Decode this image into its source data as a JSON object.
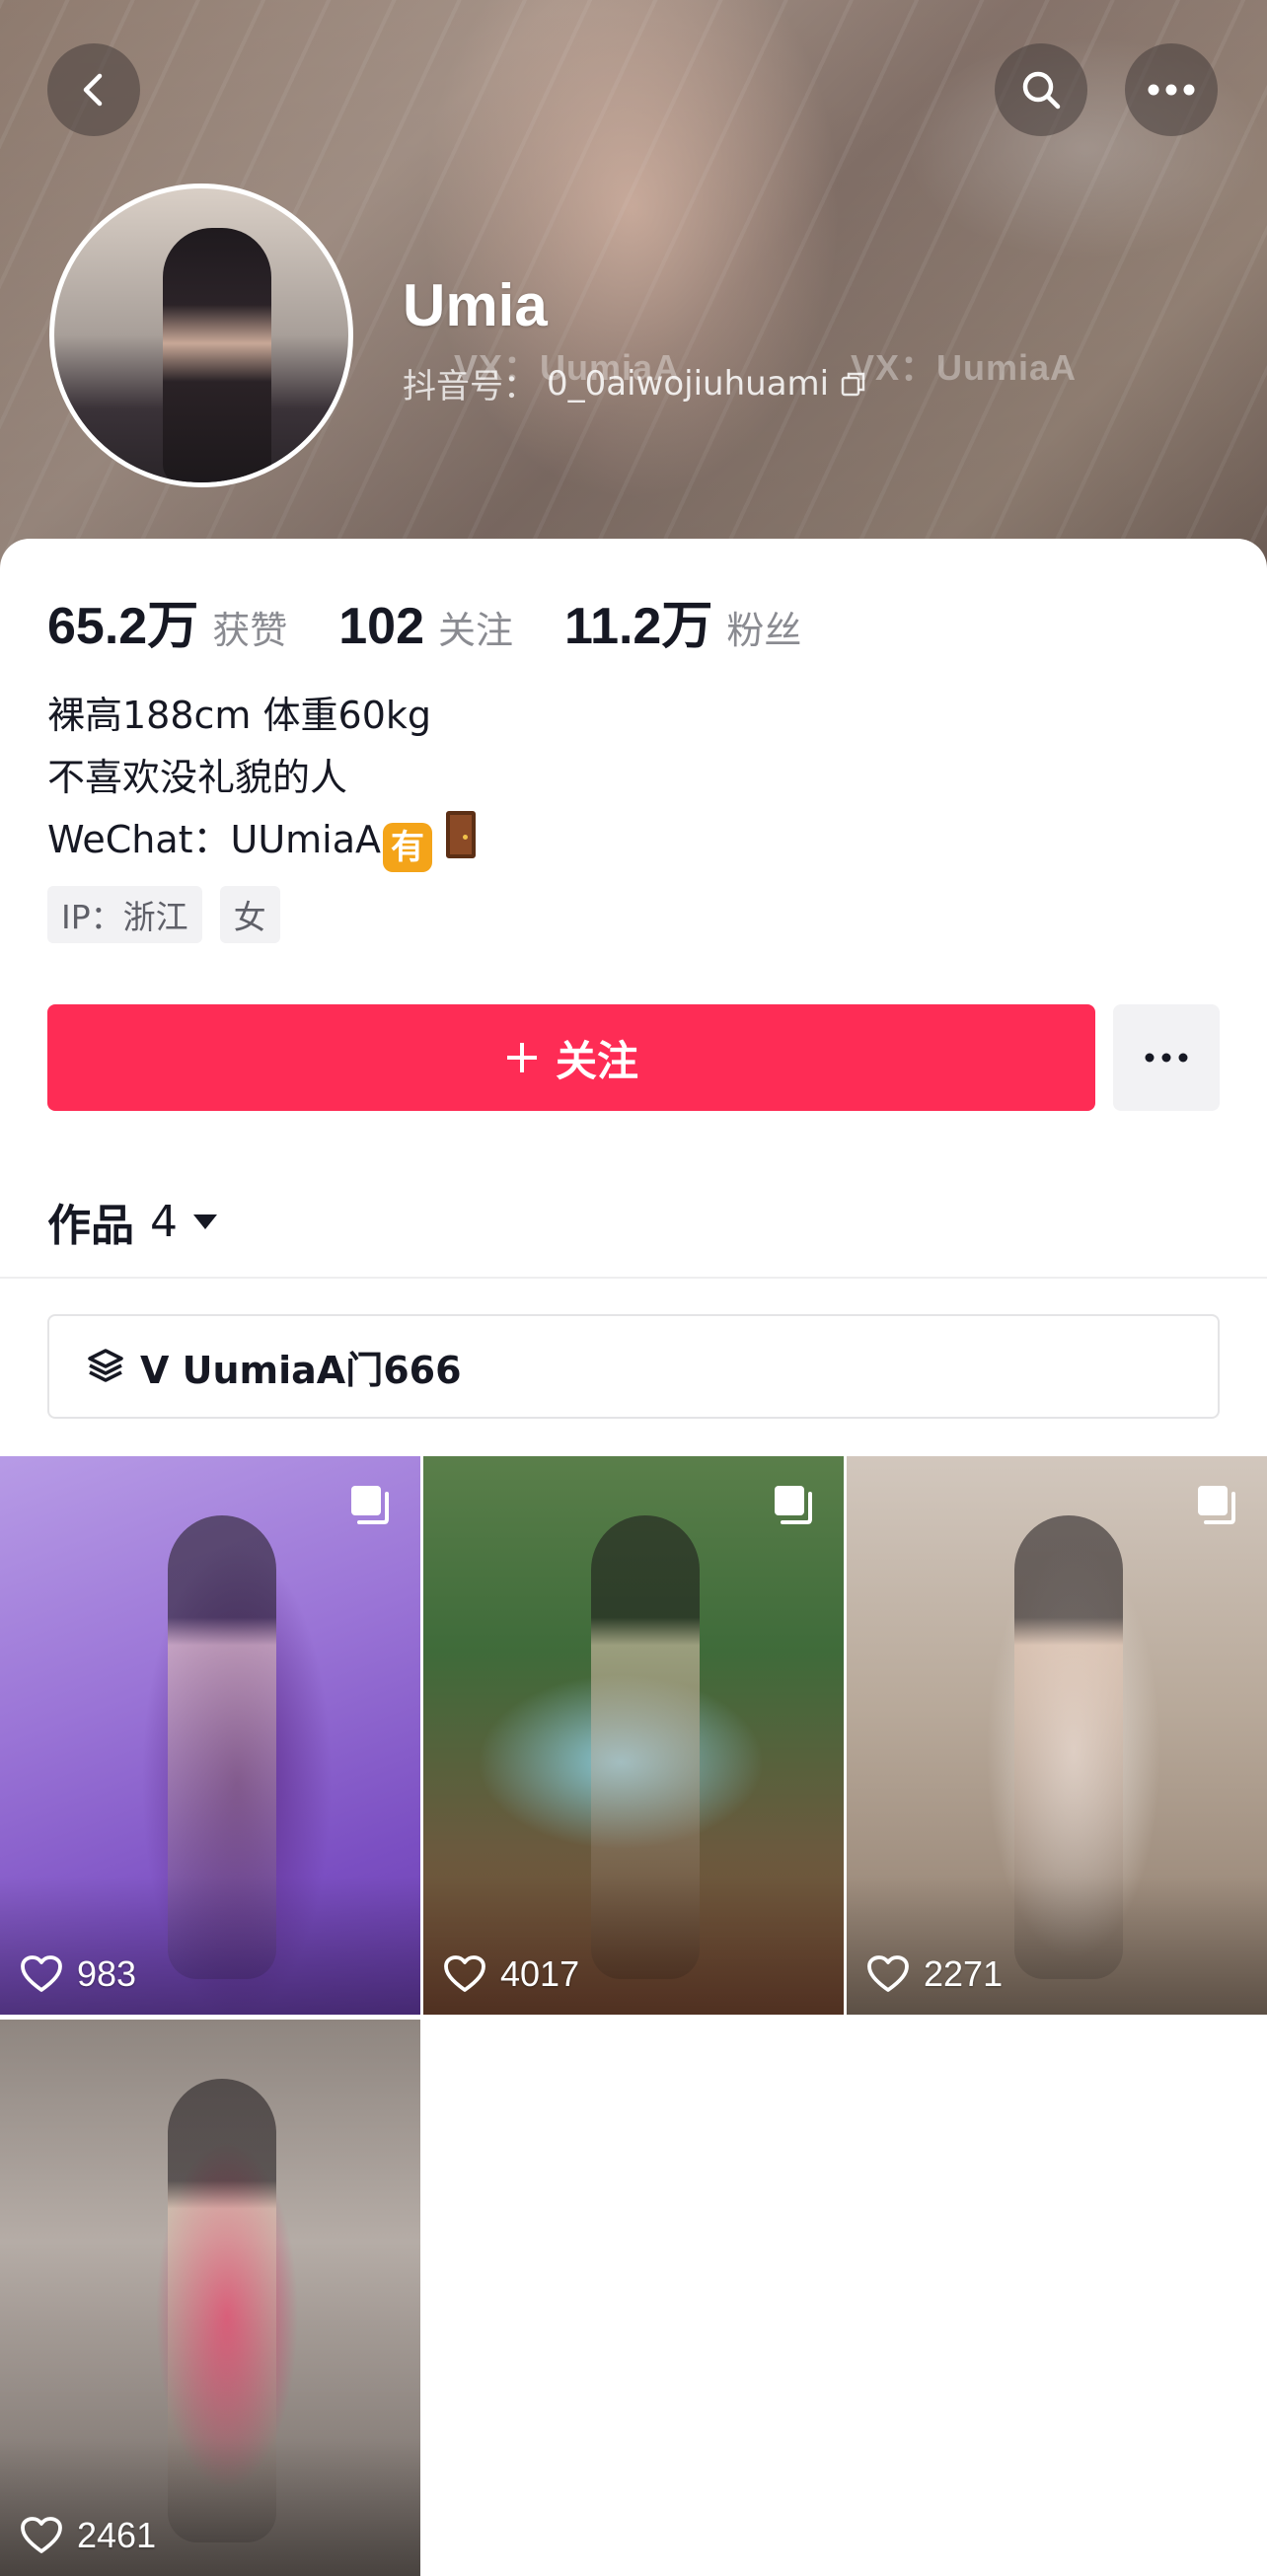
{
  "header": {
    "username": "Umia",
    "uid_label": "抖音号：",
    "uid_value": "0_0aiwojiuhuami",
    "watermarks": [
      "VX：UumiaA",
      "VX：UumiaA"
    ]
  },
  "stats": [
    {
      "value": "65.2万",
      "label": "获赞"
    },
    {
      "value": "102",
      "label": "关注"
    },
    {
      "value": "11.2万",
      "label": "粉丝"
    }
  ],
  "bio": {
    "line1": "裸高188cm 体重60kg",
    "line2": "不喜欢没礼貌的人",
    "line3_prefix": "WeChat：UUmiaA",
    "badge_char": "有"
  },
  "tags": [
    "IP：浙江",
    "女"
  ],
  "follow_button": {
    "label": "关注"
  },
  "works_tab": {
    "label": "作品",
    "count": "4"
  },
  "collection": {
    "label": "V  UumiaA门666"
  },
  "posts": [
    {
      "likes": "983"
    },
    {
      "likes": "4017"
    },
    {
      "likes": "2271"
    },
    {
      "likes": "2461"
    }
  ],
  "colors": {
    "accent": "#fe2c55",
    "text_primary": "#161823",
    "text_secondary": "#8a8b91",
    "tag_bg": "#f2f2f4"
  },
  "icons": [
    "back-icon",
    "search-icon",
    "more-icon",
    "copy-icon",
    "plus-icon",
    "caret-down-icon",
    "layers-icon",
    "multi-image-icon",
    "heart-icon"
  ]
}
